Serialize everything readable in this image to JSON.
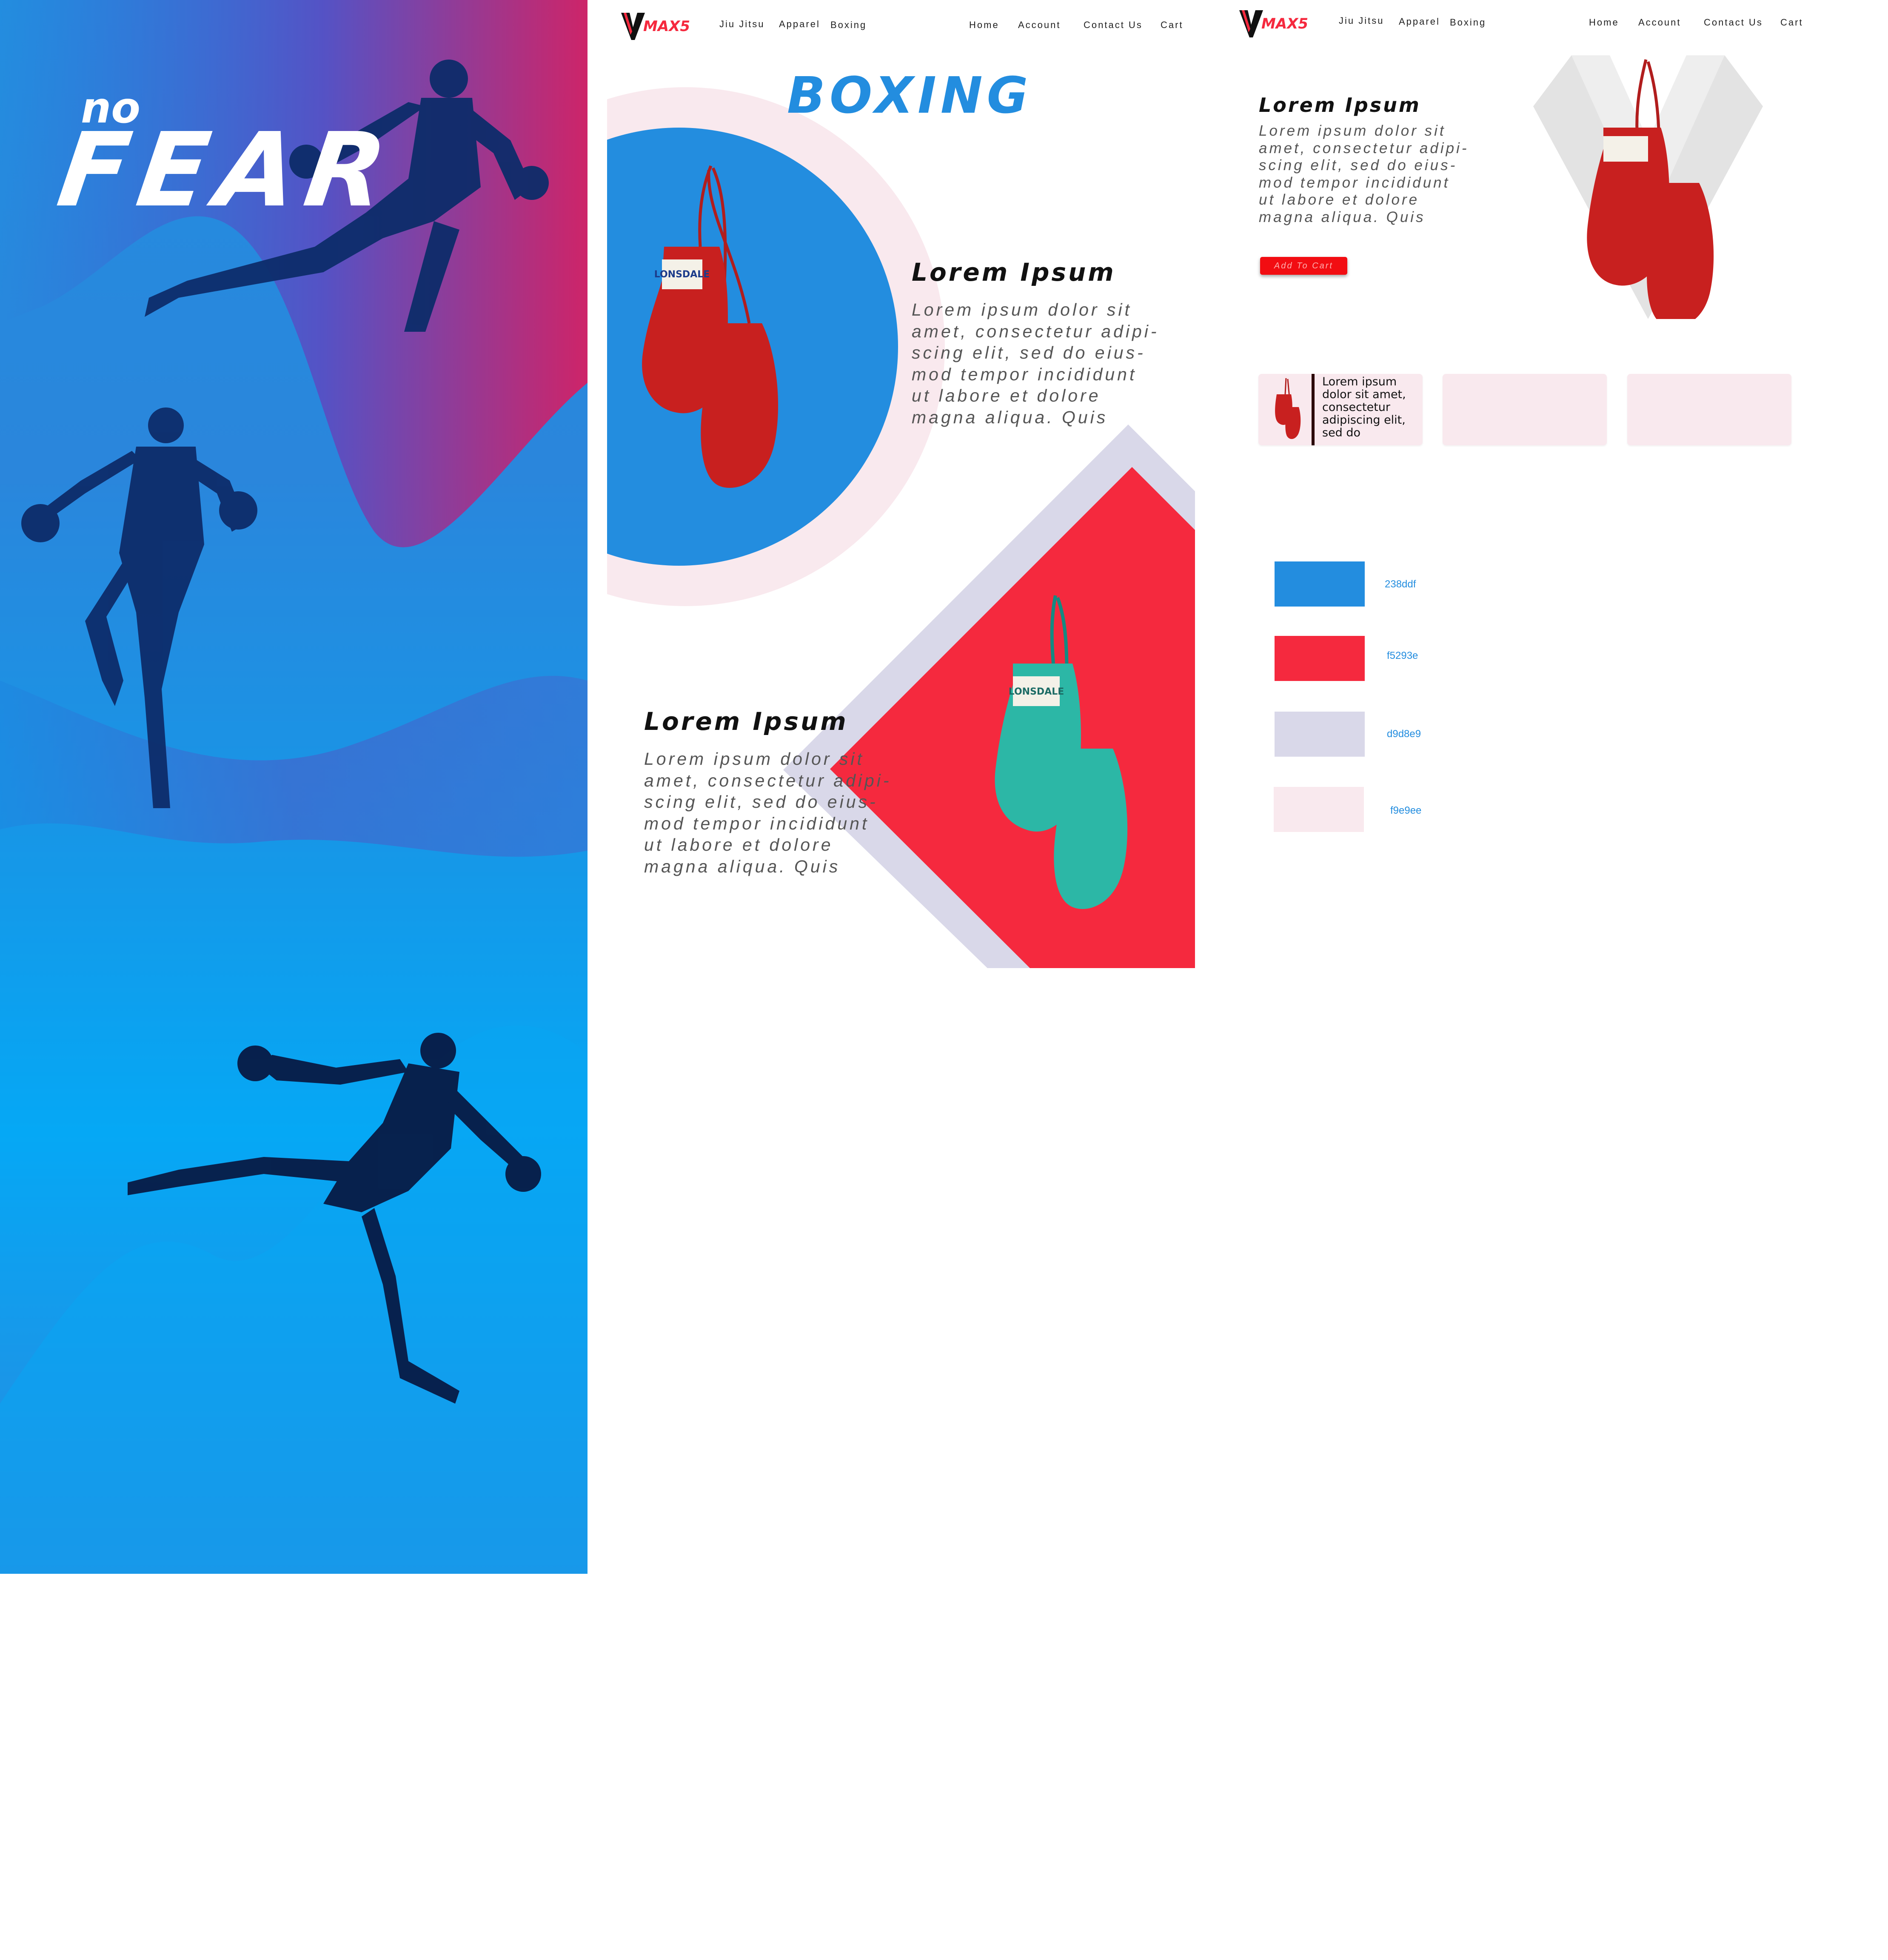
{
  "colors": {
    "blue": "#238ddf",
    "red": "#f5293e",
    "lavender": "#d9d8e9",
    "pink": "#f9e9ee",
    "teal": "#2cb7a6"
  },
  "poster": {
    "small_word": "no",
    "big_word": "FEAR"
  },
  "nav": {
    "logo": "MAX5",
    "left_links": [
      "Jiu Jitsu",
      "Apparel",
      "Boxing"
    ],
    "right_links": [
      "Home",
      "Account",
      "Contact Us",
      "Cart"
    ]
  },
  "boxing_page": {
    "title": "BOXING",
    "section1": {
      "heading": "Lorem Ipsum",
      "body": "Lorem ipsum dolor sit\namet, consectetur adipi-\nscing elit, sed do eius-\nmod tempor incididunt\nut labore et dolore\nmagna aliqua. Quis"
    },
    "section2": {
      "heading": "Lorem Ipsum",
      "body": "Lorem ipsum dolor sit\namet, consectetur adipi-\nscing elit, sed do eius-\nmod tempor incididunt\nut labore et dolore\nmagna aliqua. Quis"
    },
    "glove_brand": "LONSDALE"
  },
  "product_page": {
    "heading": "Lorem Ipsum",
    "body": "Lorem ipsum dolor sit\namet, consectetur adipi-\nscing elit, sed do eius-\nmod tempor incididunt\nut labore et dolore\nmagna aliqua. Quis",
    "add_to_cart": "Add To Cart",
    "card_text": "Lorem ipsum\ndolor sit amet,\nconsectetur\nadipiscing elit,\nsed do"
  },
  "palette": [
    {
      "hex": "#238ddf",
      "label": "238ddf"
    },
    {
      "hex": "#f5293e",
      "label": "f5293e"
    },
    {
      "hex": "#d9d8e9",
      "label": "d9d8e9"
    },
    {
      "hex": "#f9e9ee",
      "label": "f9e9ee"
    }
  ]
}
